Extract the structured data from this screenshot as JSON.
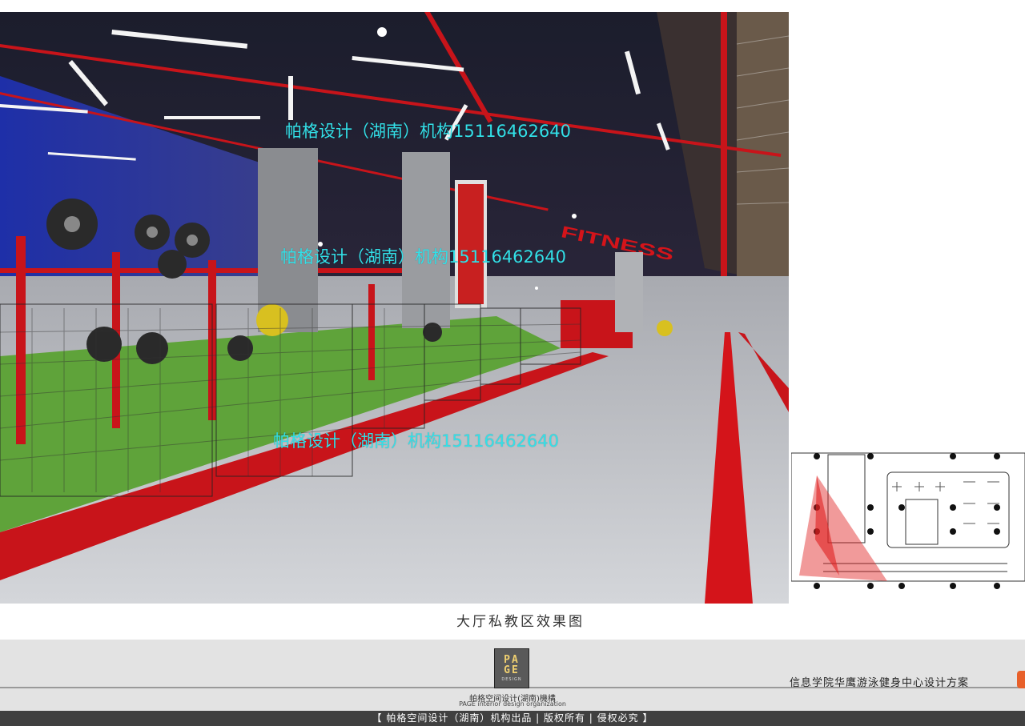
{
  "watermarks": [
    "帕格设计（湖南）机构15116462640",
    "帕格设计（湖南）机构15116462640",
    "帕格设计（湖南）机构15116462640"
  ],
  "floor_marking": "FITNESS",
  "caption": "大厅私教区效果图",
  "logo": {
    "text_top": "PA",
    "text_bottom": "GE",
    "subtext": "DESIGN"
  },
  "org_name_cn": "帕格空间设计(湖南)機構",
  "org_name_en": "PAGE interior design organization",
  "project_title": "信息学院华鹰游泳健身中心设计方案",
  "copyright": "【 帕格空间设计（湖南）机构出品 | 版权所有 | 侵权必究 】",
  "colors": {
    "accent_red": "#d4141a",
    "watermark": "#33e0e8",
    "footer_bg": "#e3e3e3",
    "bar_bg": "#404040"
  }
}
